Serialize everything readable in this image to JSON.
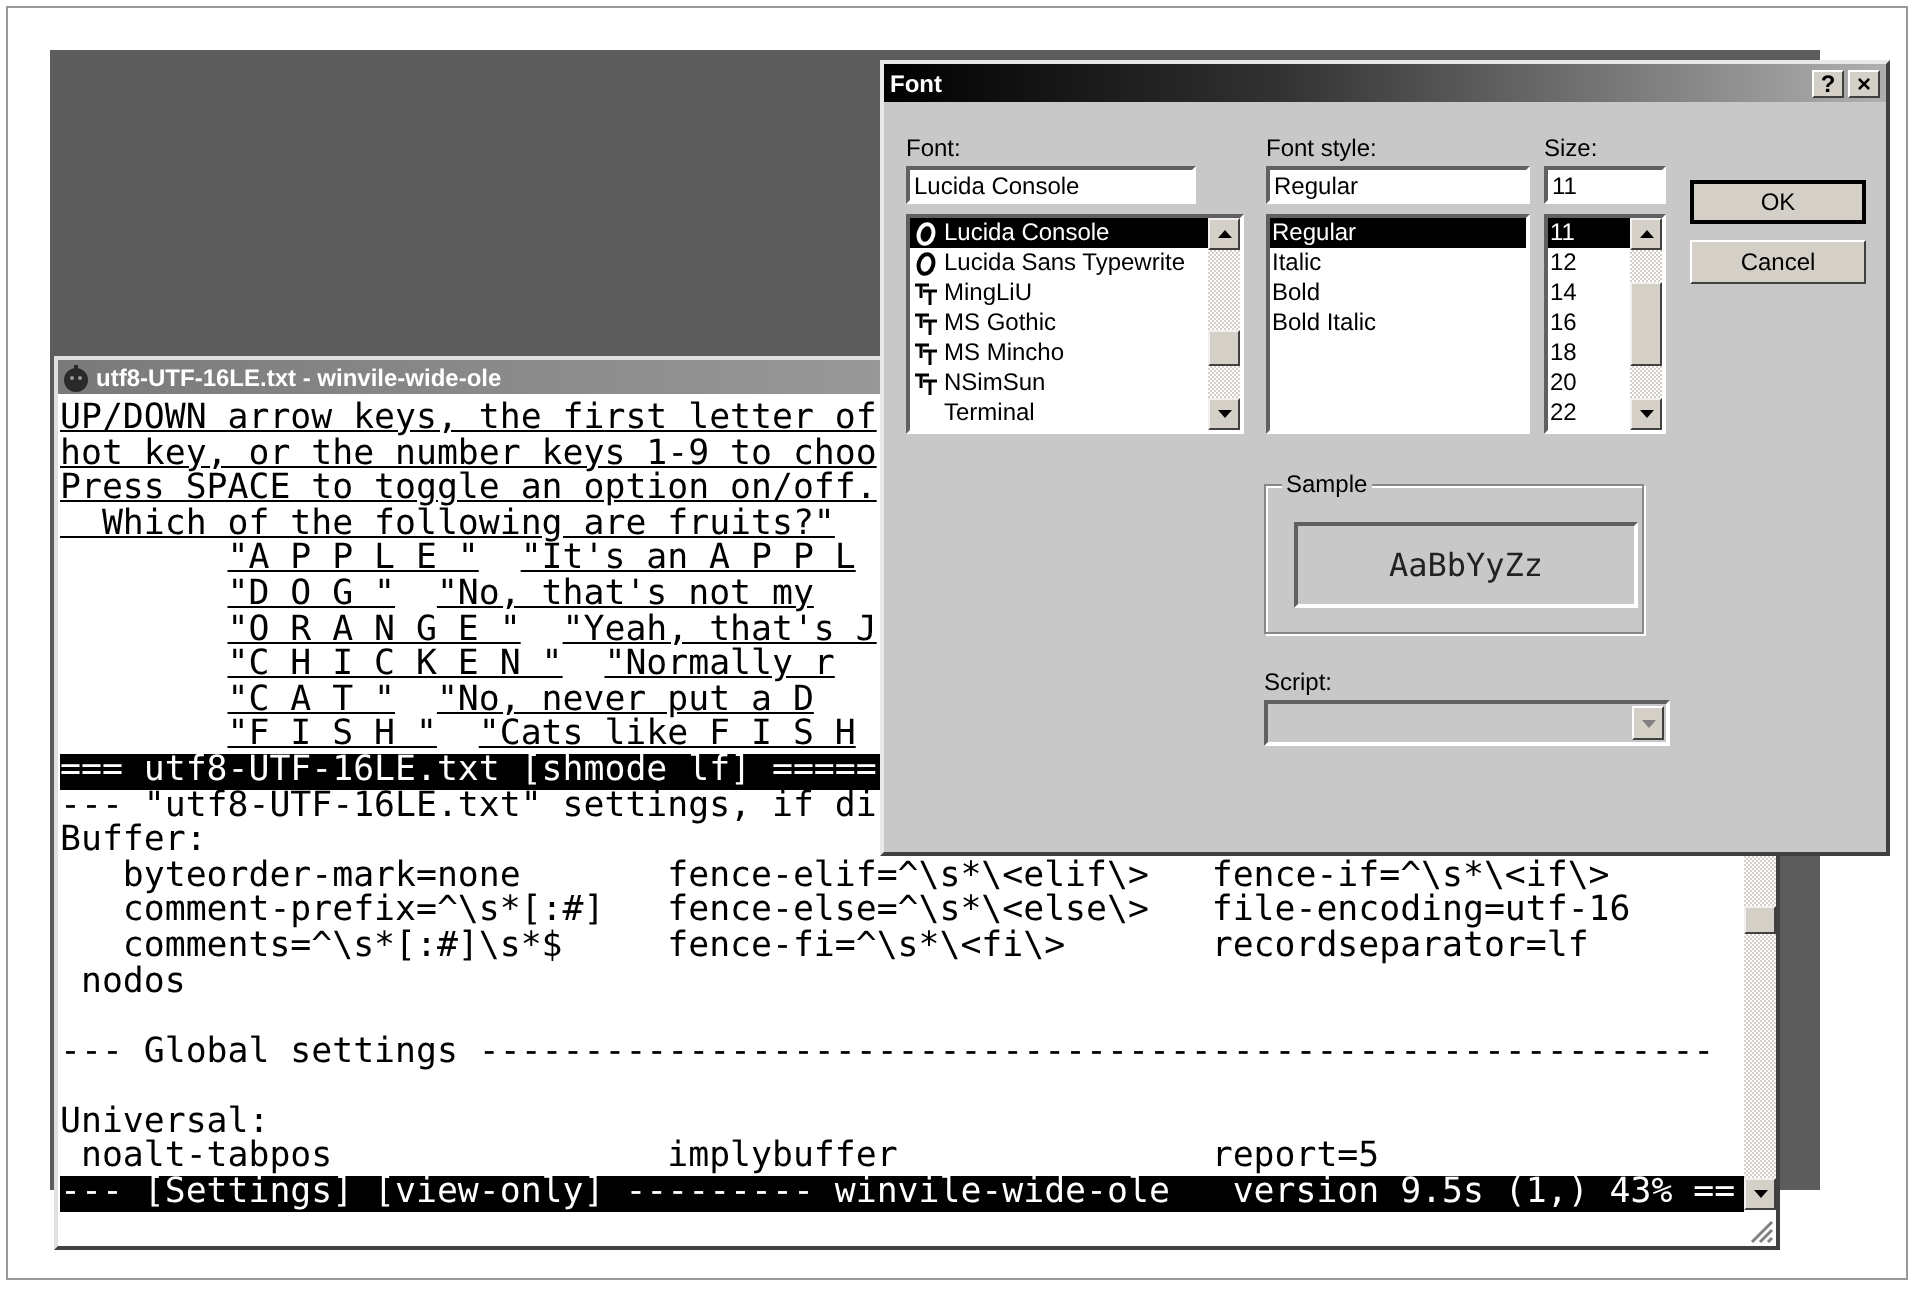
{
  "editor": {
    "title": "utf8-UTF-16LE.txt - winvile-wide-ole",
    "prompt_lines": [
      "UP/DOWN arrow keys, the first letter of",
      "hot key, or the number keys 1-9 to choo",
      "Press SPACE to toggle an option on/off."
    ],
    "question": "  Which of the following are fruits?\"",
    "options": [
      {
        "label": "\"A P P L E \"",
        "reply": "\"It's an A P P L"
      },
      {
        "label": "\"D O G \"",
        "reply": "\"No, that's not my"
      },
      {
        "label": "\"O R A N G E \"",
        "reply": "\"Yeah, that's J"
      },
      {
        "label": "\"C H I C K E N \"",
        "reply": "\"Normally r"
      },
      {
        "label": "\"C A T \"",
        "reply": "\"No, never put a D"
      },
      {
        "label": "\"F I S H \"",
        "reply": "\"Cats like F I S H"
      }
    ],
    "mode_line": "=== utf8-UTF-16LE.txt [shmode lf] =====",
    "settings_header": "--- \"utf8-UTF-16LE.txt\" settings, if di",
    "buffer_label": "Buffer:",
    "buffer_settings": [
      [
        "byteorder-mark=none",
        "fence-elif=^\\s*\\<elif\\>",
        "fence-if=^\\s*\\<if\\>"
      ],
      [
        "comment-prefix=^\\s*[:#]",
        "fence-else=^\\s*\\<else\\>",
        "file-encoding=utf-16"
      ],
      [
        "comments=^\\s*[:#]\\s*$",
        "fence-fi=^\\s*\\<fi\\>",
        "recordseparator=lf"
      ]
    ],
    "buffer_flags": [
      "nodos"
    ],
    "global_header": "--- Global settings -----------------------------------------------------------",
    "universal_label": "Universal:",
    "universal_settings": [
      [
        "noalt-tabpos",
        "implybuffer",
        "report=5"
      ]
    ],
    "status_line": "--- [Settings] [view-only] --------- winvile-wide-ole   version 9.5s (1,) 43% =="
  },
  "font_dialog": {
    "title": "Font",
    "help_button": "?",
    "close_button": "×",
    "font": {
      "label": "Font:",
      "value": "Lucida Console",
      "items": [
        {
          "name": "Lucida Console",
          "kind": "opentype",
          "selected": true
        },
        {
          "name": "Lucida Sans Typewrite",
          "kind": "opentype",
          "selected": false
        },
        {
          "name": "MingLiU",
          "kind": "truetype",
          "selected": false
        },
        {
          "name": "MS Gothic",
          "kind": "truetype",
          "selected": false
        },
        {
          "name": "MS Mincho",
          "kind": "truetype",
          "selected": false
        },
        {
          "name": "NSimSun",
          "kind": "truetype",
          "selected": false
        },
        {
          "name": "Terminal",
          "kind": "raster",
          "selected": false
        }
      ]
    },
    "style": {
      "label": "Font style:",
      "value": "Regular",
      "items": [
        {
          "name": "Regular",
          "selected": true
        },
        {
          "name": "Italic",
          "selected": false
        },
        {
          "name": "Bold",
          "selected": false
        },
        {
          "name": "Bold Italic",
          "selected": false
        }
      ]
    },
    "size": {
      "label": "Size:",
      "value": "11",
      "items": [
        {
          "name": "11",
          "selected": true
        },
        {
          "name": "12",
          "selected": false
        },
        {
          "name": "14",
          "selected": false
        },
        {
          "name": "16",
          "selected": false
        },
        {
          "name": "18",
          "selected": false
        },
        {
          "name": "20",
          "selected": false
        },
        {
          "name": "22",
          "selected": false
        }
      ]
    },
    "buttons": [
      {
        "label": "OK",
        "default": true
      },
      {
        "label": "Cancel",
        "default": false
      }
    ],
    "sample": {
      "label": "Sample",
      "text": "AaBbYyZz"
    },
    "script": {
      "label": "Script:",
      "disabled": true
    }
  }
}
